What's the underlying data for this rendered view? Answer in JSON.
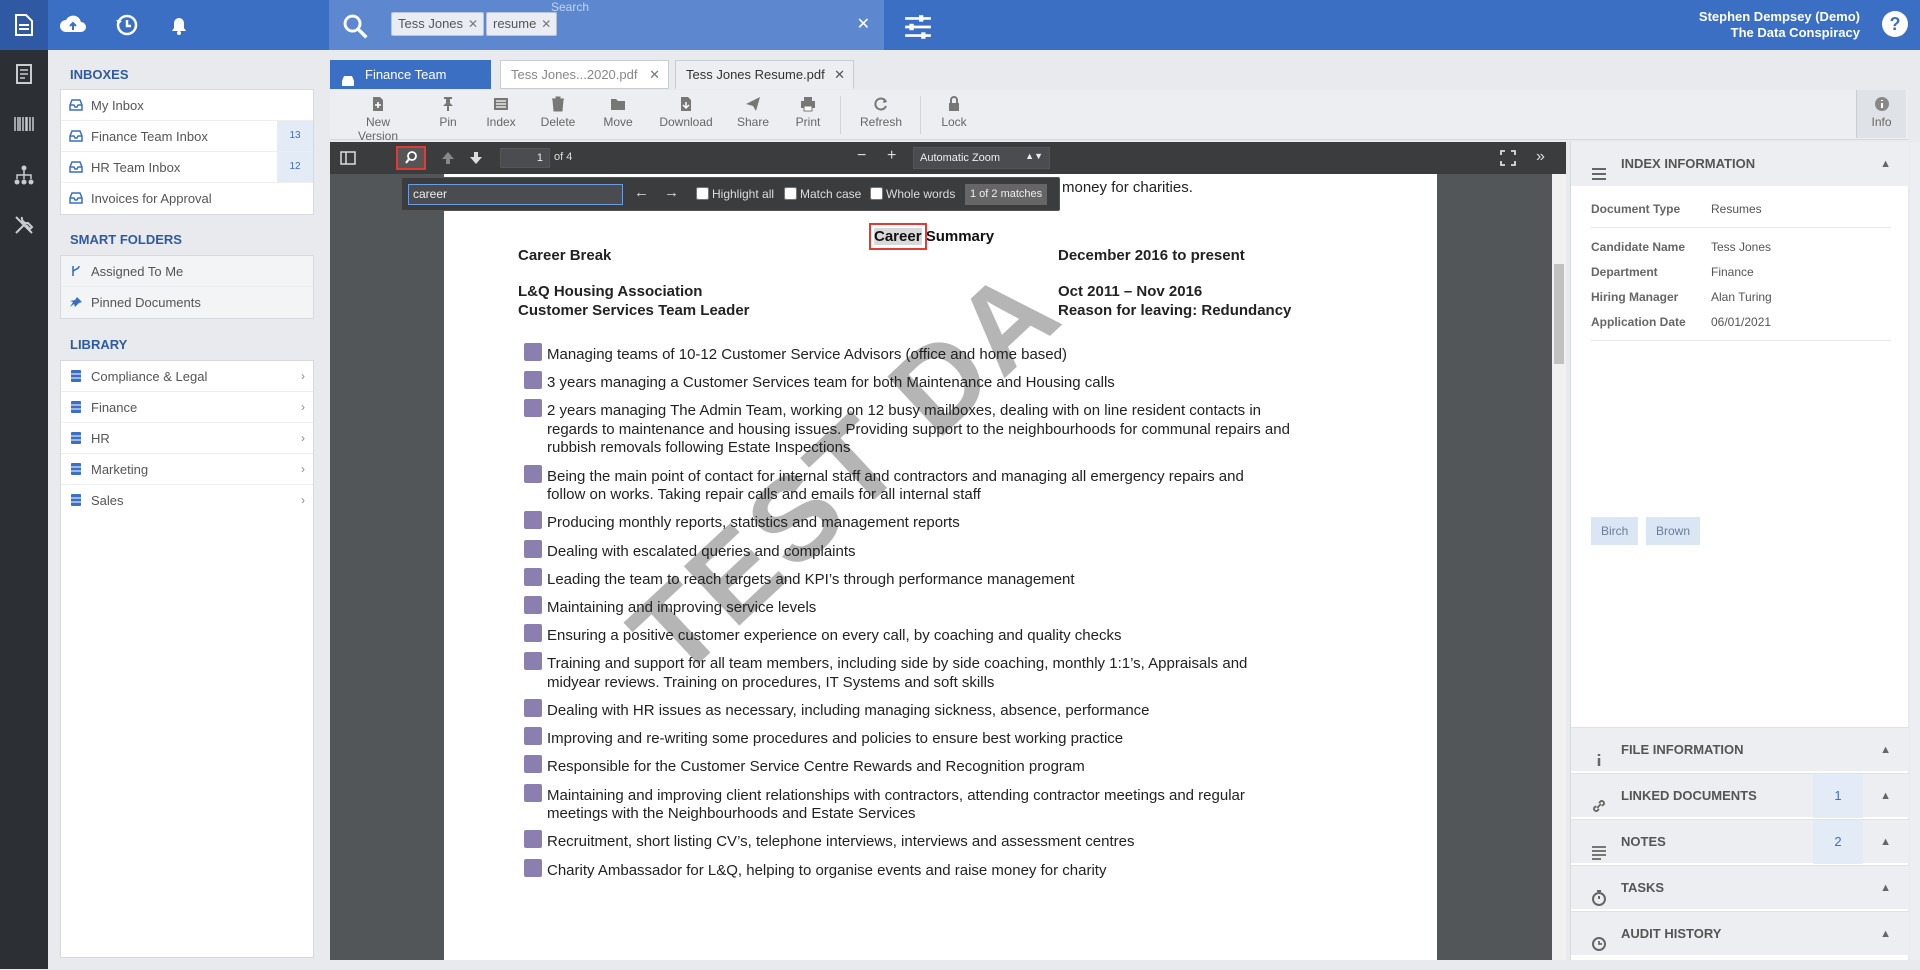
{
  "header": {
    "search_placeholder": "Search",
    "chips": [
      {
        "label": "Tess Jones"
      },
      {
        "label": "resume"
      }
    ],
    "user_name": "Stephen Dempsey (Demo)",
    "user_org": "The Data Conspiracy",
    "help_label": "?"
  },
  "sidebar": {
    "inboxes_title": "INBOXES",
    "inboxes": [
      {
        "label": "My Inbox",
        "count": ""
      },
      {
        "label": "Finance Team Inbox",
        "count": "13"
      },
      {
        "label": "HR Team Inbox",
        "count": "12"
      },
      {
        "label": "Invoices for Approval",
        "count": ""
      }
    ],
    "smart_title": "SMART FOLDERS",
    "smart": [
      {
        "label": "Assigned To Me"
      },
      {
        "label": "Pinned Documents"
      }
    ],
    "library_title": "LIBRARY",
    "library": [
      {
        "label": "Compliance & Legal"
      },
      {
        "label": "Finance"
      },
      {
        "label": "HR"
      },
      {
        "label": "Marketing"
      },
      {
        "label": "Sales"
      }
    ]
  },
  "tabs": [
    {
      "label": "Finance Team Inbox"
    },
    {
      "label": "Tess Jones...2020.pdf"
    },
    {
      "label": "Tess Jones Resume.pdf"
    }
  ],
  "toolbar": {
    "buttons": [
      {
        "label": "New Version"
      },
      {
        "label": "Pin"
      },
      {
        "label": "Index"
      },
      {
        "label": "Delete"
      },
      {
        "label": "Move"
      },
      {
        "label": "Download"
      },
      {
        "label": "Share"
      },
      {
        "label": "Print"
      },
      {
        "label": "Refresh"
      },
      {
        "label": "Lock"
      }
    ],
    "info_label": "Info"
  },
  "viewer": {
    "page_number": "1",
    "page_total": "of 4",
    "zoom": "Automatic Zoom",
    "find": {
      "query": "career",
      "highlight_all": "Highlight all",
      "match_case": "Match case",
      "whole_words": "Whole words",
      "matches": "1 of 2 matches"
    }
  },
  "document": {
    "partial_top": "money for charities.",
    "watermark": "TEST DA",
    "section_title": "Career Summary",
    "highlight_word": "Career",
    "title_rest": " Summary",
    "entries": [
      {
        "left": "Career Break",
        "right": "December 2016 to present"
      },
      {
        "left": "L&Q Housing Association",
        "right": "Oct 2011 – Nov 2016"
      },
      {
        "left": "Customer Services Team Leader",
        "right": "Reason for leaving: Redundancy"
      }
    ],
    "bullets": [
      [
        "Managing teams of 10-12 Customer Service Advisors (office and home based)"
      ],
      [
        "3 years managing a Customer Services team for both Maintenance and Housing calls"
      ],
      [
        "2 years managing The Admin Team, working on 12 busy mailboxes, dealing with on line resident contacts in",
        "regards to maintenance and housing issues. Providing support to the neighbourhoods for communal repairs and",
        "rubbish removals following Estate Inspections"
      ],
      [
        "Being the main point of contact for internal staff and contractors and managing all emergency repairs and",
        "follow on works. Taking repair calls and emails for all internal staff"
      ],
      [
        "Producing monthly reports, statistics and management reports"
      ],
      [
        "Dealing with escalated queries and complaints"
      ],
      [
        "Leading the team to reach targets and KPI’s through performance management"
      ],
      [
        "Maintaining and improving service levels"
      ],
      [
        "Ensuring a positive customer experience on every call, by coaching and quality checks"
      ],
      [
        "Training and support for all team members, including side by side coaching, monthly 1:1’s, Appraisals and",
        "midyear reviews. Training on procedures, IT Systems and soft skills"
      ],
      [
        "Dealing with HR issues as necessary, including managing sickness, absence, performance"
      ],
      [
        "Improving and re-writing some procedures and policies to ensure best working practice"
      ],
      [
        "Responsible for the Customer Service Centre Rewards and Recognition program"
      ],
      [
        "Maintaining and improving client relationships with contractors, attending contractor meetings and regular",
        "meetings with the Neighbourhoods and Estate Services"
      ],
      [
        "Recruitment, short listing CV’s, telephone interviews, interviews and assessment centres"
      ],
      [
        "Charity Ambassador for L&Q, helping to organise events and raise money for charity"
      ]
    ]
  },
  "right_panel": {
    "index_title": "INDEX INFORMATION",
    "fields": [
      {
        "key": "Document Type",
        "value": "Resumes"
      },
      {
        "key": "Candidate Name",
        "value": "Tess Jones"
      },
      {
        "key": "Department",
        "value": "Finance"
      },
      {
        "key": "Hiring Manager",
        "value": "Alan Turing"
      },
      {
        "key": "Application Date",
        "value": "06/01/2021"
      }
    ],
    "tags": [
      {
        "label": "Birch"
      },
      {
        "label": "Brown"
      }
    ],
    "sections": [
      {
        "label": "FILE INFORMATION",
        "count": ""
      },
      {
        "label": "LINKED DOCUMENTS",
        "count": "1"
      },
      {
        "label": "NOTES",
        "count": "2"
      },
      {
        "label": "TASKS",
        "count": ""
      },
      {
        "label": "AUDIT HISTORY",
        "count": ""
      }
    ]
  },
  "colors": {
    "brand": "#3b6fc4",
    "rail": "#2c2f33",
    "highlight_box": "#e53935"
  }
}
